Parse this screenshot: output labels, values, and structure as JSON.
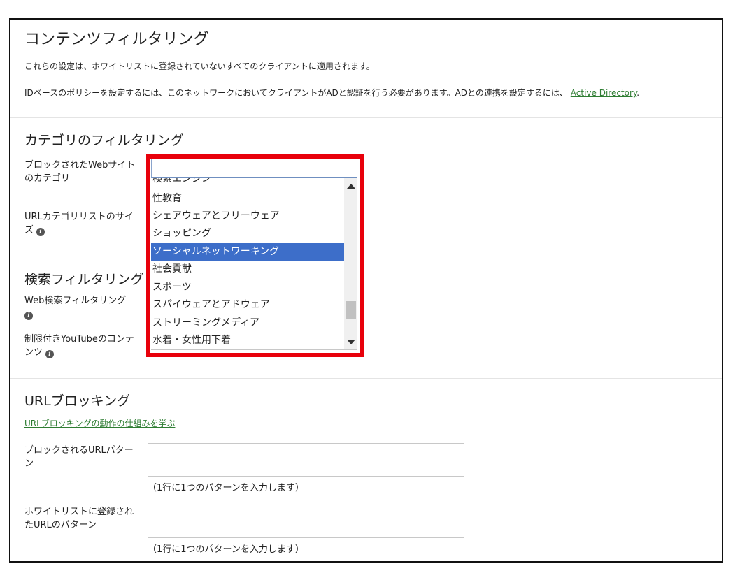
{
  "content_filtering": {
    "title": "コンテンツフィルタリング",
    "desc1": "これらの設定は、ホワイトリストに登録されていないすべてのクライアントに適用されます。",
    "desc2_prefix": "IDベースのポリシーを設定するには、このネットワークにおいてクライアントがADと認証を行う必要があります。ADとの連携を設定するには、",
    "desc2_link": "Active Directory",
    "desc2_suffix": "."
  },
  "category_filtering": {
    "title": "カテゴリのフィルタリング",
    "blocked_categories_label": "ブロックされたWebサイトのカテゴリ",
    "url_list_size_label": "URLカテゴリリストのサイズ",
    "listbox": {
      "partial_top_option": "検索エンジン",
      "options": [
        "性教育",
        "シェアウェアとフリーウェア",
        "ショッピング",
        "ソーシャルネットワーキング",
        "社会貢献",
        "スポーツ",
        "スパイウェアとアドウェア",
        "ストリーミングメディア",
        "水着・女性用下着"
      ],
      "selected": "ソーシャルネットワーキング"
    }
  },
  "search_filtering": {
    "title": "検索フィルタリング",
    "web_search_label": "Web検索フィルタリング",
    "youtube_label": "制限付きYouTubeのコンテンツ"
  },
  "url_blocking": {
    "title": "URLブロッキング",
    "learn_link": "URLブロッキングの動作の仕組みを学ぶ",
    "blocked_patterns_label": "ブロックされるURLパターン",
    "blocked_patterns_value": "",
    "blocked_hint": "（1行に1つのパターンを入力します）",
    "whitelist_patterns_label": "ホワイトリストに登録されたURLのパターン",
    "whitelist_patterns_value": "",
    "whitelist_hint": "（1行に1つのパターンを入力します）"
  },
  "colors": {
    "selection": "#3d6ec9",
    "link": "#2e7d32",
    "highlight_border": "#e8000b"
  }
}
